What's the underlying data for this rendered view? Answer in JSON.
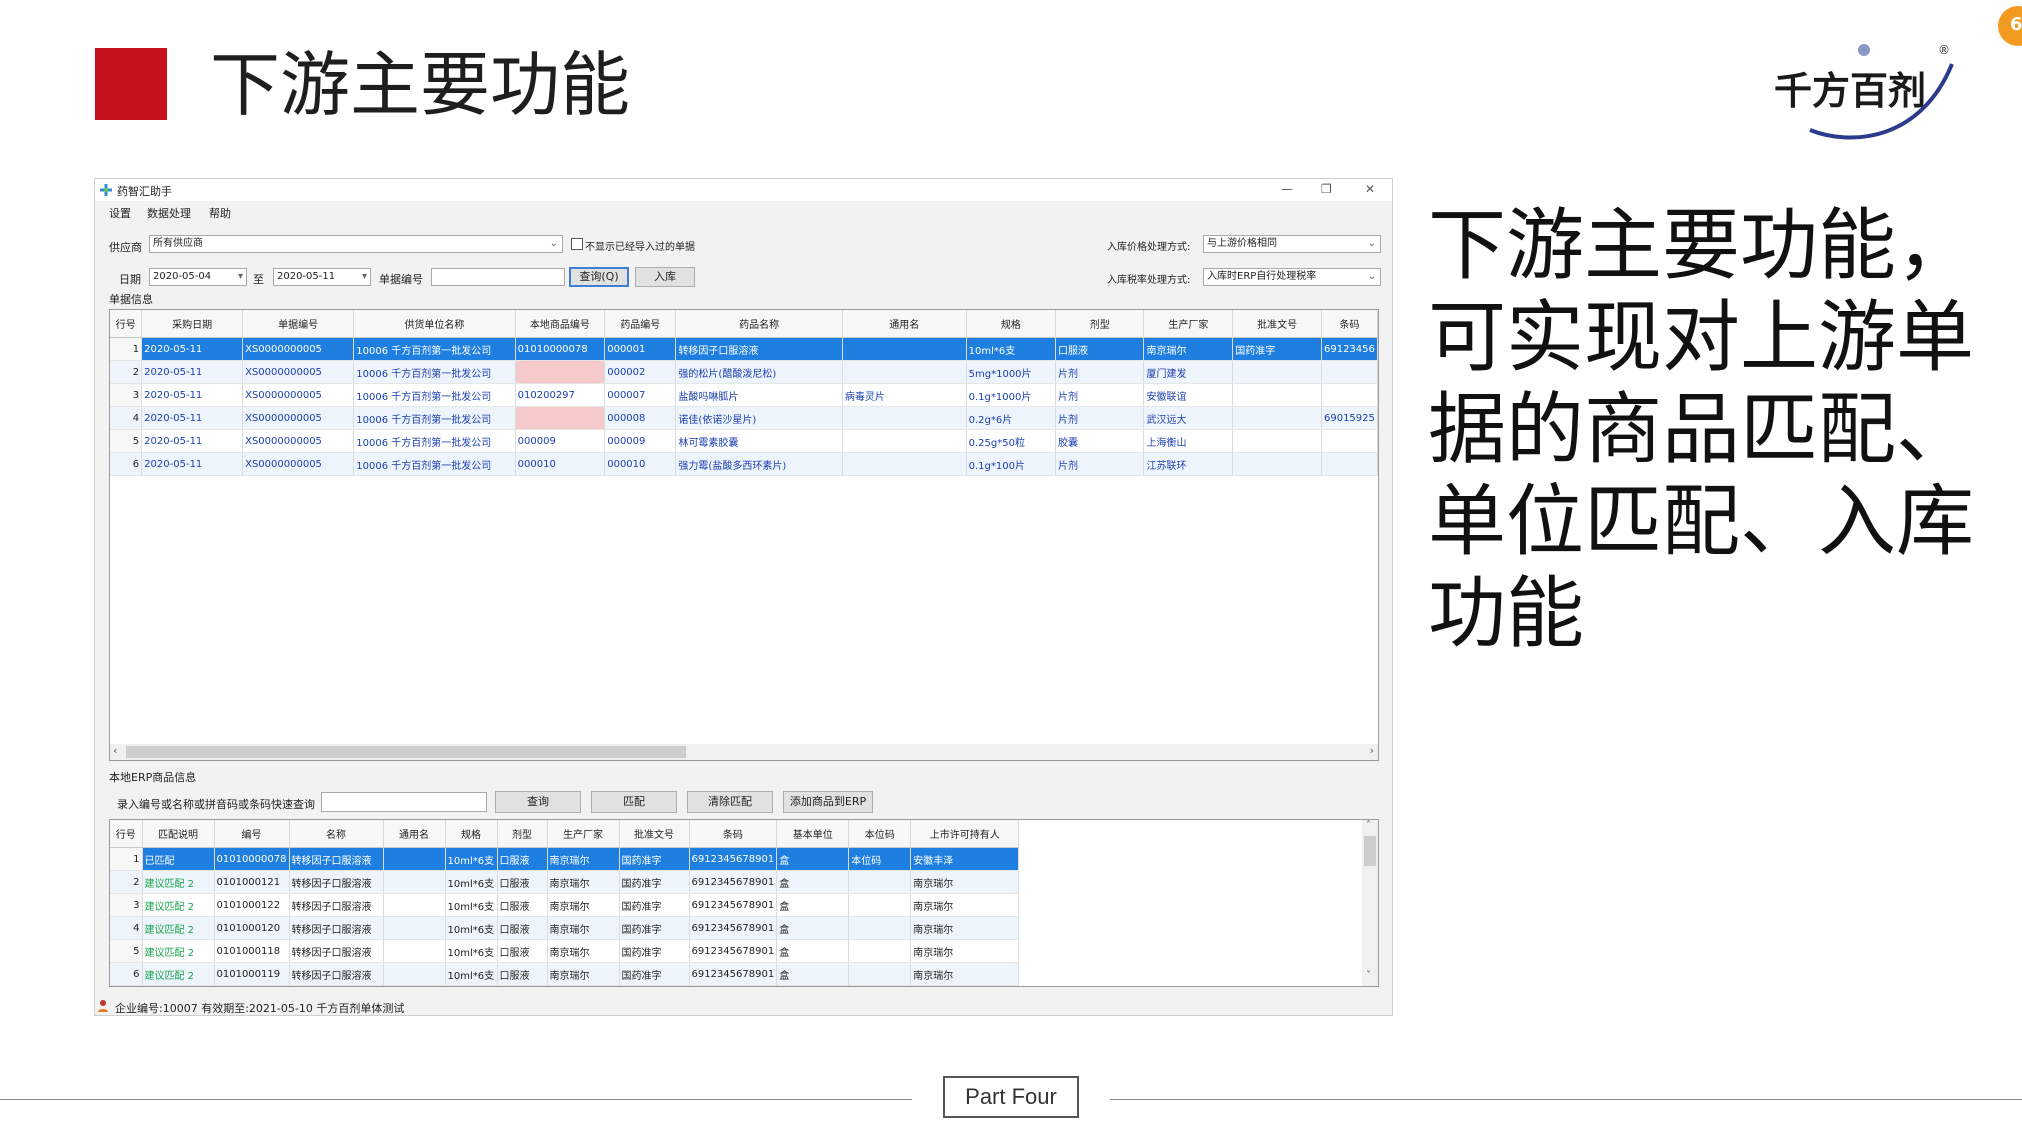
{
  "slide": {
    "title": "下游主要功能",
    "side_text": "下游主要功能，可实现对上游单据的商品匹配、单位匹配、入库功能",
    "part_label": "Part Four",
    "accent_color": "#c4121c"
  },
  "logo": {
    "text": "千方百剂",
    "reg": "®"
  },
  "corner_badge": {
    "text": "6"
  },
  "app": {
    "title": "药智汇助手",
    "window_buttons": {
      "minimize": "—",
      "restore": "❐",
      "close": "✕"
    },
    "menu": [
      "设置",
      "数据处理",
      "帮助"
    ],
    "filters": {
      "supplier_label": "供应商",
      "supplier_value": "所有供应商",
      "hide_checkbox_label": "不显示已经导入过的单据",
      "date_label": "日期",
      "date_from": "2020-05-04",
      "to_label": "至",
      "date_to": "2020-05-11",
      "doc_no_label": "单据编号",
      "doc_no_value": "",
      "query_button": "查询(Q)",
      "stock_in_button": "入库",
      "price_mode_label": "入库价格处理方式:",
      "price_mode_value": "与上游价格相同",
      "tax_mode_label": "入库税率处理方式:",
      "tax_mode_value": "入库时ERP自行处理税率"
    },
    "doc_section_label": "单据信息",
    "doc_table": {
      "columns": [
        "行号",
        "采购日期",
        "单据编号",
        "供货单位名称",
        "本地商品编号",
        "药品编号",
        "药品名称",
        "通用名",
        "规格",
        "剂型",
        "生产厂家",
        "批准文号",
        "条码"
      ],
      "rows": [
        [
          "1",
          "2020-05-11",
          "XS0000000005",
          "10006 千方百剂第一批发公司",
          "01010000078",
          "000001",
          "转移因子口服溶液",
          "",
          "10ml*6支",
          "口服液",
          "南京瑞尔",
          "国药准字",
          "69123456"
        ],
        [
          "2",
          "2020-05-11",
          "XS0000000005",
          "10006 千方百剂第一批发公司",
          "",
          "000002",
          "强的松片(醋酸泼尼松)",
          "",
          "5mg*1000片",
          "片剂",
          "厦门建发",
          "",
          ""
        ],
        [
          "3",
          "2020-05-11",
          "XS0000000005",
          "10006 千方百剂第一批发公司",
          "010200297",
          "000007",
          "盐酸吗啉胍片",
          "病毒灵片",
          "0.1g*1000片",
          "片剂",
          "安徽联谊",
          "",
          ""
        ],
        [
          "4",
          "2020-05-11",
          "XS0000000005",
          "10006 千方百剂第一批发公司",
          "",
          "000008",
          "诺佳(依诺沙星片)",
          "",
          "0.2g*6片",
          "片剂",
          "武汉远大",
          "",
          "69015925"
        ],
        [
          "5",
          "2020-05-11",
          "XS0000000005",
          "10006 千方百剂第一批发公司",
          "000009",
          "000009",
          "林可霉素胶囊",
          "",
          "0.25g*50粒",
          "胶囊",
          "上海衡山",
          "",
          ""
        ],
        [
          "6",
          "2020-05-11",
          "XS0000000005",
          "10006 千方百剂第一批发公司",
          "000010",
          "000010",
          "强力霉(盐酸多西环素片)",
          "",
          "0.1g*100片",
          "片剂",
          "江苏联环",
          "",
          ""
        ]
      ]
    },
    "erp_section_label": "本地ERP商品信息",
    "erp_search": {
      "label": "录入编号或名称或拼音码或条码快速查询",
      "value": "",
      "query_button": "查询",
      "match_button": "匹配",
      "clear_match_button": "清除匹配",
      "add_to_erp_button": "添加商品到ERP"
    },
    "erp_table": {
      "columns": [
        "行号",
        "匹配说明",
        "编号",
        "名称",
        "通用名",
        "规格",
        "剂型",
        "生产厂家",
        "批准文号",
        "条码",
        "基本单位",
        "本位码",
        "上市许可持有人"
      ],
      "rows": [
        [
          "1",
          "已匹配",
          "01010000078",
          "转移因子口服溶液",
          "",
          "10ml*6支",
          "口服液",
          "南京瑞尔",
          "国药准字",
          "6912345678901",
          "盒",
          "本位码",
          "安徽丰泽"
        ],
        [
          "2",
          "建议匹配 2",
          "0101000121",
          "转移因子口服溶液",
          "",
          "10ml*6支",
          "口服液",
          "南京瑞尔",
          "国药准字",
          "6912345678901",
          "盒",
          "",
          "南京瑞尔"
        ],
        [
          "3",
          "建议匹配 2",
          "0101000122",
          "转移因子口服溶液",
          "",
          "10ml*6支",
          "口服液",
          "南京瑞尔",
          "国药准字",
          "6912345678901",
          "盒",
          "",
          "南京瑞尔"
        ],
        [
          "4",
          "建议匹配 2",
          "0101000120",
          "转移因子口服溶液",
          "",
          "10ml*6支",
          "口服液",
          "南京瑞尔",
          "国药准字",
          "6912345678901",
          "盒",
          "",
          "南京瑞尔"
        ],
        [
          "5",
          "建议匹配 2",
          "0101000118",
          "转移因子口服溶液",
          "",
          "10ml*6支",
          "口服液",
          "南京瑞尔",
          "国药准字",
          "6912345678901",
          "盒",
          "",
          "南京瑞尔"
        ],
        [
          "6",
          "建议匹配 2",
          "0101000119",
          "转移因子口服溶液",
          "",
          "10ml*6支",
          "口服液",
          "南京瑞尔",
          "国药准字",
          "6912345678901",
          "盒",
          "",
          "南京瑞尔"
        ]
      ]
    },
    "status_bar": "企业编号:10007 有效期至:2021-05-10 千方百剂单体测试"
  }
}
